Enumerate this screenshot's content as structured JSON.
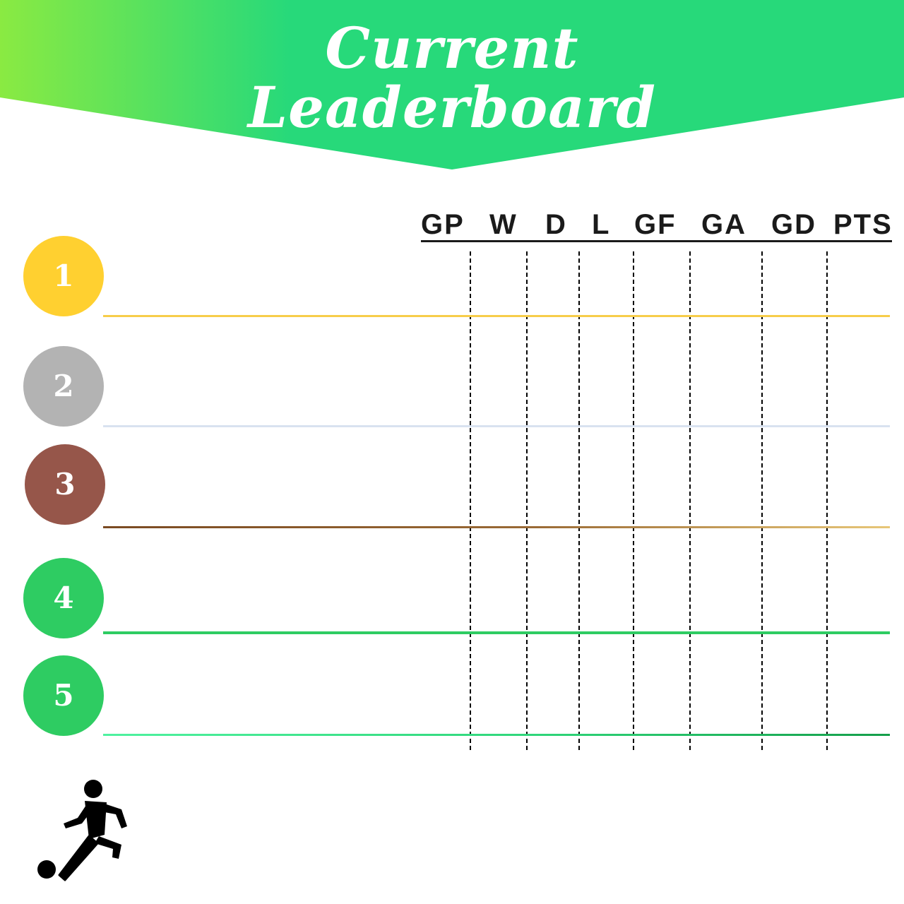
{
  "title": {
    "line1": "Current",
    "line2": "Leaderboard"
  },
  "columns": [
    "GP",
    "W",
    "D",
    "L",
    "GF",
    "GA",
    "GD",
    "PTS"
  ],
  "ranks": [
    {
      "label": "1",
      "color": "#FFD030",
      "line_color": "#F7CD4A"
    },
    {
      "label": "2",
      "color": "#B3B3B3",
      "line_color": "#D9E2F0"
    },
    {
      "label": "3",
      "color": "#96564A",
      "line_color": "#7A4A22"
    },
    {
      "label": "4",
      "color": "#2ECC62",
      "line_color": "#2ECC62"
    },
    {
      "label": "5",
      "color": "#2ECC62",
      "line_color": "#35D98A"
    }
  ],
  "colors": {
    "banner_start": "#8AEA42",
    "banner_end": "#27D97A",
    "text_dark": "#1A1A1A"
  },
  "icons": {
    "player": "soccer-player-icon"
  }
}
